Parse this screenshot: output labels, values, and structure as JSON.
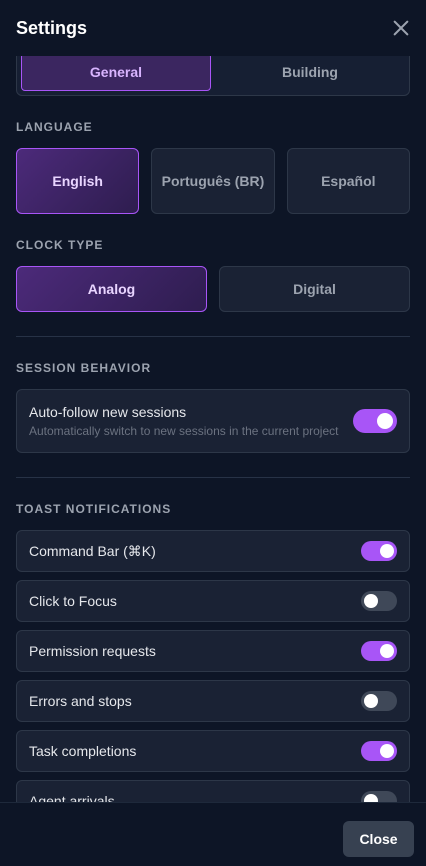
{
  "header": {
    "title": "Settings"
  },
  "tabs": [
    {
      "label": "General",
      "active": true
    },
    {
      "label": "Building",
      "active": false
    }
  ],
  "language": {
    "label": "LANGUAGE",
    "options": [
      {
        "label": "English",
        "active": true
      },
      {
        "label": "Português (BR)",
        "active": false
      },
      {
        "label": "Español",
        "active": false
      }
    ]
  },
  "clock": {
    "label": "CLOCK TYPE",
    "options": [
      {
        "label": "Analog",
        "active": true
      },
      {
        "label": "Digital",
        "active": false
      }
    ]
  },
  "session": {
    "label": "SESSION BEHAVIOR",
    "title": "Auto-follow new sessions",
    "subtitle": "Automatically switch to new sessions in the current project",
    "enabled": true
  },
  "toasts": {
    "label": "TOAST NOTIFICATIONS",
    "items": [
      {
        "label": "Command Bar (⌘K)",
        "enabled": true
      },
      {
        "label": "Click to Focus",
        "enabled": false
      },
      {
        "label": "Permission requests",
        "enabled": true
      },
      {
        "label": "Errors and stops",
        "enabled": false
      },
      {
        "label": "Task completions",
        "enabled": true
      },
      {
        "label": "Agent arrivals",
        "enabled": false
      }
    ]
  },
  "footer": {
    "close_label": "Close"
  },
  "colors": {
    "accent": "#a855f7",
    "background": "#0d1526",
    "card": "#1a2234"
  }
}
